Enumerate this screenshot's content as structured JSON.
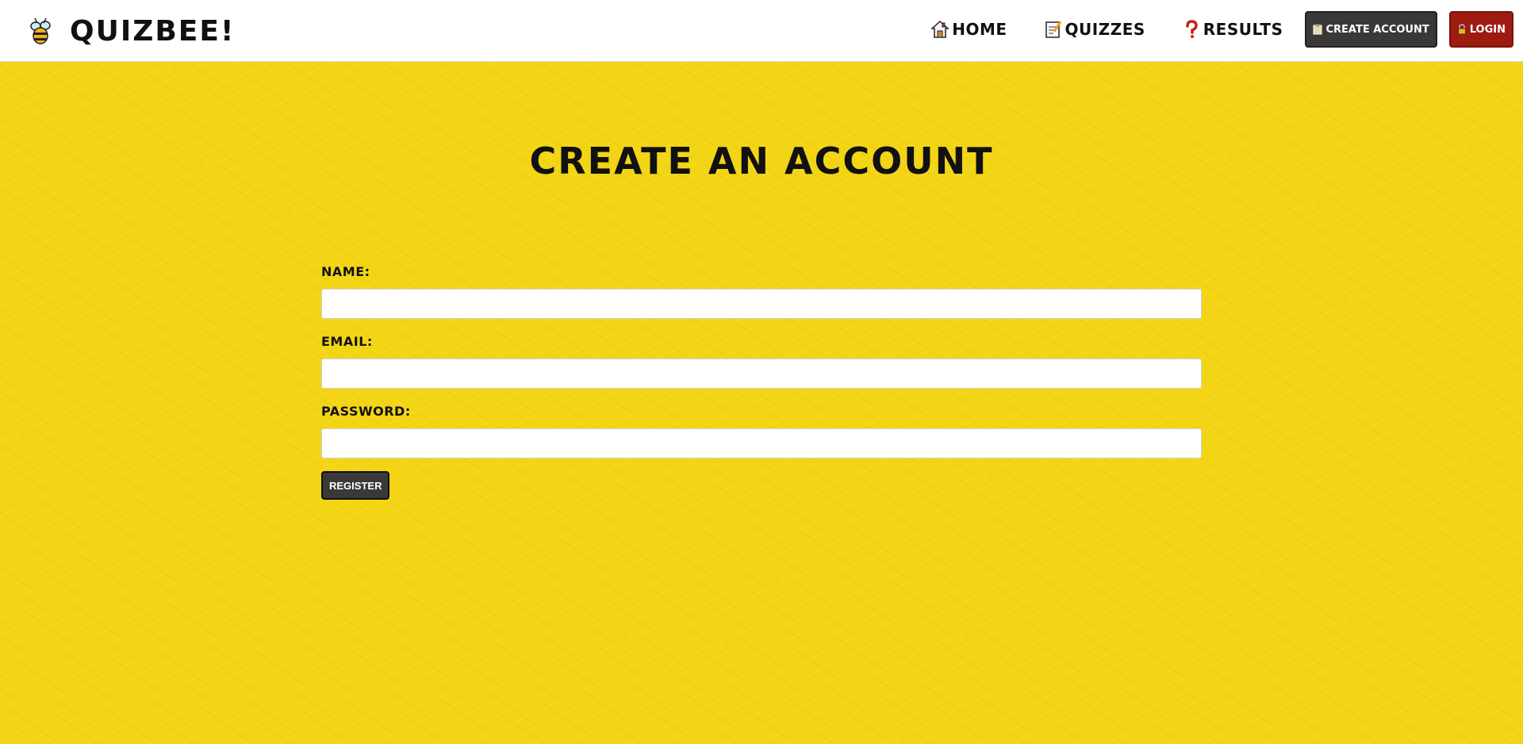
{
  "brand": {
    "name": "Quizbee!",
    "icon": "bee-icon"
  },
  "nav": {
    "home": {
      "label": "Home",
      "icon": "house-icon"
    },
    "quizzes": {
      "label": "Quizzes",
      "icon": "memo-icon"
    },
    "results": {
      "label": "Results",
      "icon": "question-mark-icon"
    },
    "create_account": {
      "label": "Create Account",
      "icon": "clipboard-icon"
    },
    "login": {
      "label": "Login",
      "icon": "lock-icon"
    }
  },
  "page": {
    "title": "Create an Account"
  },
  "form": {
    "name_label": "Name:",
    "name_value": "",
    "email_label": "Email:",
    "email_value": "",
    "password_label": "Password:",
    "password_value": "",
    "submit_label": "Register"
  },
  "colors": {
    "background": "#f3d516",
    "navbar": "#ffffff",
    "dark_button": "#3b3838",
    "login_button": "#9e1b12"
  }
}
